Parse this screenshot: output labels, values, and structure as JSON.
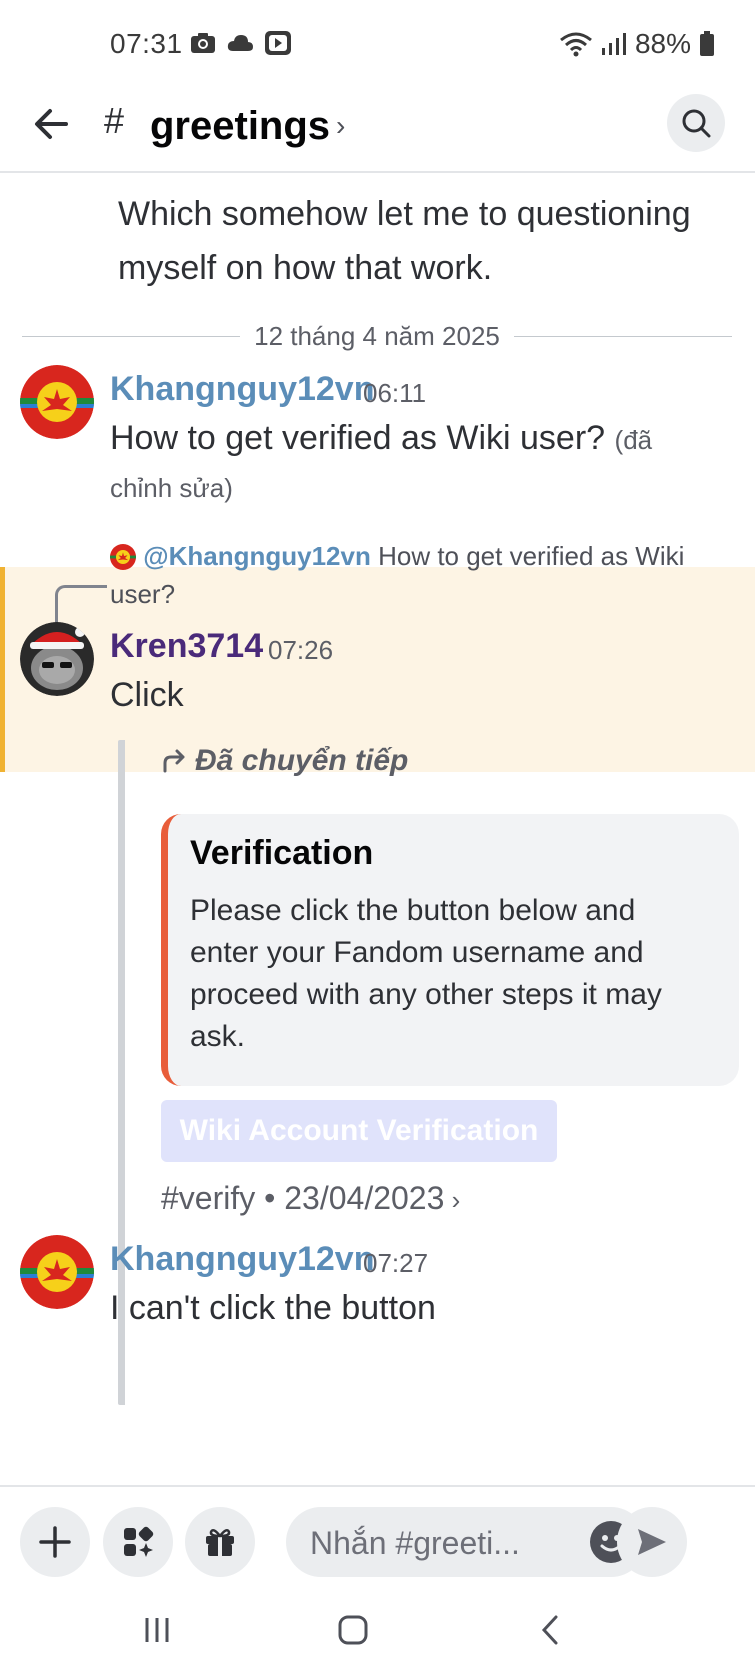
{
  "status_bar": {
    "time": "07:31",
    "battery": "88%",
    "left_icons": [
      "camera-icon",
      "cloud-icon",
      "youtube-icon"
    ],
    "right_icons": [
      "wifi-icon",
      "signal-icon",
      "battery-icon"
    ]
  },
  "header": {
    "hash": "#",
    "channel_name": "greetings",
    "chevron": "›"
  },
  "messages": {
    "continued_text": "Which somehow let me to questioning myself on how that work.",
    "date_divider": "12 tháng 4 năm 2025",
    "msg1": {
      "username": "Khangnguy12vn",
      "time": "06:11",
      "text": "How to get verified as Wiki user?",
      "edited": "(đã chỉnh sửa)",
      "name_color": "#5b8db8"
    },
    "msg2": {
      "reply_mention": "@Khangnguy12vn",
      "reply_text": "How to get verified as Wiki user?",
      "username": "Kren3714",
      "time": "07:26",
      "text": "Click",
      "name_color": "#4a2a7a"
    },
    "forward": {
      "label": "Đã chuyển tiếp",
      "embed_title": "Verification",
      "embed_desc": "Please click the button below and enter your Fandom username and proceed with any other steps it may ask.",
      "button_label": "Wiki Account Verification",
      "footer_channel": "#verify",
      "footer_sep": " • ",
      "footer_date": "23/04/2023",
      "footer_chev": " ›"
    },
    "msg3": {
      "username": "Khangnguy12vn",
      "time": "07:27",
      "text": "I can't click the button"
    }
  },
  "input_bar": {
    "placeholder": "Nhắn #greeti..."
  },
  "colors": {
    "accent_highlight": "#fdf4e4",
    "highlight_border": "#f0b232",
    "embed_border": "#e85d3a"
  }
}
